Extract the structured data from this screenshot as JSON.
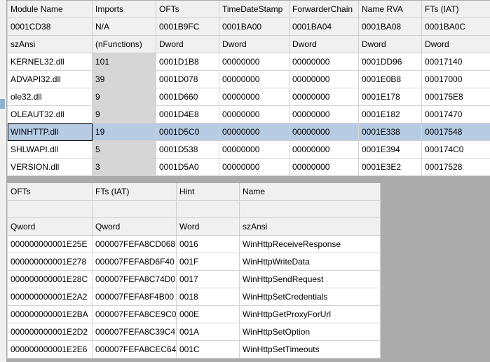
{
  "imports": {
    "headers": [
      "Module Name",
      "Imports",
      "OFTs",
      "TimeDateStamp",
      "ForwarderChain",
      "Name RVA",
      "FTs (IAT)"
    ],
    "offsets": [
      "0001CD38",
      "N/A",
      "0001B9FC",
      "0001BA00",
      "0001BA04",
      "0001BA08",
      "0001BA0C"
    ],
    "types": [
      "szAnsi",
      "(nFunctions)",
      "Dword",
      "Dword",
      "Dword",
      "Dword",
      "Dword"
    ],
    "rows": [
      [
        "KERNEL32.dll",
        "101",
        "0001D1B8",
        "00000000",
        "00000000",
        "0001DD96",
        "00017140"
      ],
      [
        "ADVAPI32.dll",
        "39",
        "0001D078",
        "00000000",
        "00000000",
        "0001E0B8",
        "00017000"
      ],
      [
        "ole32.dll",
        "9",
        "0001D660",
        "00000000",
        "00000000",
        "0001E178",
        "000175E8"
      ],
      [
        "OLEAUT32.dll",
        "9",
        "0001D4E8",
        "00000000",
        "00000000",
        "0001E182",
        "00017470"
      ],
      [
        "WINHTTP.dll",
        "19",
        "0001D5C0",
        "00000000",
        "00000000",
        "0001E338",
        "00017548"
      ],
      [
        "SHLWAPI.dll",
        "5",
        "0001D538",
        "00000000",
        "00000000",
        "0001E394",
        "000174C0"
      ],
      [
        "VERSION.dll",
        "3",
        "0001D5A0",
        "00000000",
        "00000000",
        "0001E3E2",
        "00017528"
      ]
    ],
    "selected_row": 4
  },
  "functions": {
    "headers": [
      "OFTs",
      "FTs (IAT)",
      "Hint",
      "Name"
    ],
    "offsets": [
      "",
      "",
      "",
      ""
    ],
    "types": [
      "Qword",
      "Qword",
      "Word",
      "szAnsi"
    ],
    "rows": [
      [
        "000000000001E25E",
        "000007FEFA8CD068",
        "0016",
        "WinHttpReceiveResponse"
      ],
      [
        "000000000001E278",
        "000007FEFA8D6F40",
        "001F",
        "WinHttpWriteData"
      ],
      [
        "000000000001E28C",
        "000007FEFA8C74D0",
        "0017",
        "WinHttpSendRequest"
      ],
      [
        "000000000001E2A2",
        "000007FEFA8F4B00",
        "0018",
        "WinHttpSetCredentials"
      ],
      [
        "000000000001E2BA",
        "000007FEFA8CE9C0",
        "000E",
        "WinHttpGetProxyForUrl"
      ],
      [
        "000000000001E2D2",
        "000007FEFA8C39C4",
        "001A",
        "WinHttpSetOption"
      ],
      [
        "000000000001E2E6",
        "000007FEFA8CEC64",
        "001C",
        "WinHttpSetTimeouts"
      ]
    ]
  }
}
